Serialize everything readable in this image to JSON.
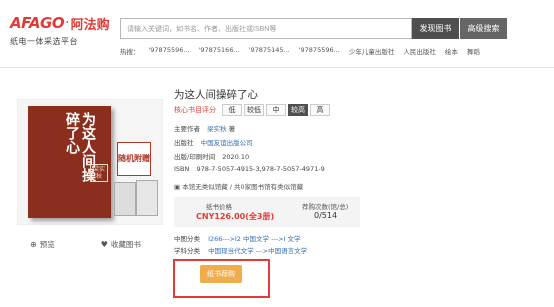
{
  "header": {
    "logo_text": "AFAGO",
    "logo_dot": "·",
    "logo_cn": "阿法购",
    "tagline": "纸电一体采选平台",
    "search_placeholder": "请输入关键词，如书名、作者、出版社或ISBN等",
    "find_button": "发现图书",
    "advanced_button": "高级搜索",
    "hot_label": "热搜：",
    "hot_terms": [
      "'97875596...",
      "'97875166...",
      "'97875145...",
      "'97875596...",
      "少年儿童出版社",
      "人民出版社",
      "绘本",
      "舞蹈"
    ]
  },
  "book": {
    "cover_title": "为这人间操碎了心",
    "cover_seal": "梁实秋",
    "cover_tag": "随机附赠",
    "title": "为这人间操碎了心",
    "rating_label": "核心书目评分",
    "levels": [
      "低",
      "较低",
      "中",
      "较高",
      "高"
    ],
    "selected_level": "较高",
    "author_key": "主要作者",
    "author": "梁实秋",
    "author_suffix": "著",
    "publisher_key": "出版社",
    "publisher": "中国友谊出版公司",
    "date_key": "出版/印刷时间",
    "date": "2020.10",
    "isbn_key": "ISBN",
    "isbn": "978-7-5057-4915-3,978-7-5057-4971-9",
    "collection_note": "本馆无类似馆藏 / 共0家图书馆有类似馆藏",
    "price_label": "纸书价格",
    "price_value": "CNY126.00(全3册)",
    "order_label": "荐购次数(馆/总)",
    "order_value": "0/514",
    "clc_key": "中图分类",
    "clc_value": "I266--->I2 中国文学 --->I 文学",
    "subject_key": "学科分类",
    "subject_value": "中国现当代文学 --->中国语言文学",
    "order_button": "纸书荐购"
  },
  "actions": {
    "zoom": "预览",
    "favorite": "收藏图书"
  }
}
